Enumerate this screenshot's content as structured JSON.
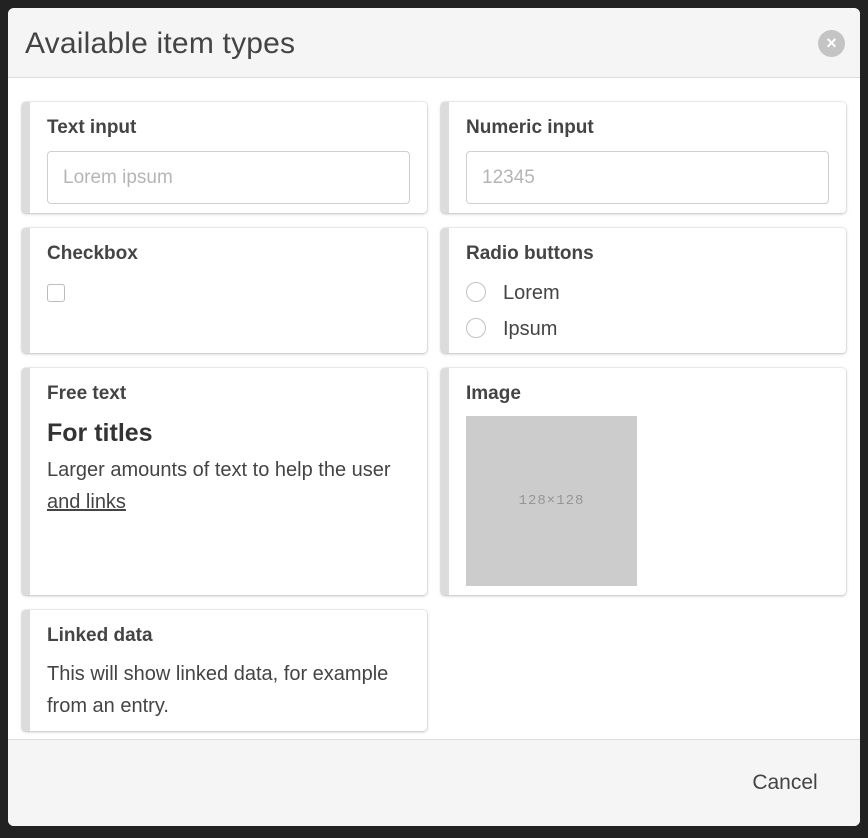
{
  "modal": {
    "title": "Available item types",
    "close_icon": "close-icon",
    "close_glyph": "×"
  },
  "cards": {
    "text_input": {
      "title": "Text input",
      "placeholder": "Lorem ipsum"
    },
    "numeric_input": {
      "title": "Numeric input",
      "placeholder": "12345"
    },
    "checkbox": {
      "title": "Checkbox",
      "checked": false
    },
    "radio_buttons": {
      "title": "Radio buttons",
      "options": [
        "Lorem",
        "Ipsum"
      ]
    },
    "free_text": {
      "title": "Free text",
      "heading": "For titles",
      "text": "Larger amounts of text to help the user ",
      "link_text": "and links"
    },
    "image": {
      "title": "Image",
      "placeholder_label": "128×128"
    },
    "linked_data": {
      "title": "Linked data",
      "text": "This will show linked data, for example from an entry."
    }
  },
  "footer": {
    "cancel_label": "Cancel"
  },
  "colors": {
    "backdrop": "#222222",
    "header_bg": "#f5f5f5",
    "card_accent": "#dcdcdc",
    "image_placeholder": "#cccccc"
  }
}
